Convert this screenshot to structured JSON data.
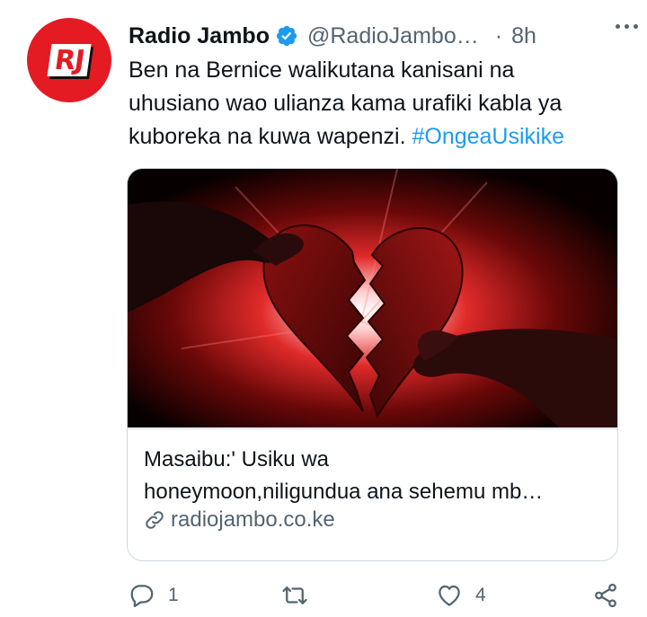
{
  "tweet": {
    "account_name": "Radio Jambo",
    "handle": "@RadioJambo…",
    "separator": "·",
    "time": "8h",
    "avatar_text": "RJ",
    "text_lines": [
      "Ben na Bernice walikutana kanisani na",
      "uhusiano wao ulianza kama urafiki kabla ya",
      "kuboreka na kuwa  wapenzi. "
    ],
    "hashtag": "#OngeaUsikike"
  },
  "card": {
    "title_line1": "Masaibu:' Usiku wa",
    "title_line2": "honeymoon,niligundua ana sehemu mb…",
    "domain": "radiojambo.co.ke",
    "image_icon": "broken-heart-hands-image"
  },
  "actions": {
    "reply_count": "1",
    "retweet_count": "",
    "like_count": "4"
  },
  "colors": {
    "brand_red": "#e41b23",
    "link_blue": "#1d9bf0",
    "secondary_text": "#536471",
    "verified_blue": "#1d9bf0"
  }
}
